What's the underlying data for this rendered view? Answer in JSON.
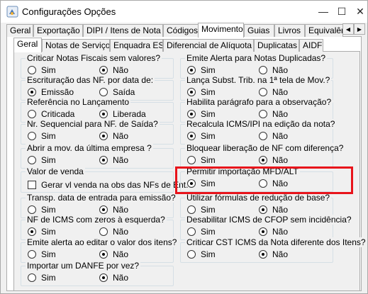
{
  "window": {
    "title": "Configurações Opções",
    "minimize": "—",
    "maximize": "☐",
    "close": "✕"
  },
  "top_tabs": [
    {
      "label": "Geral",
      "active": false
    },
    {
      "label": "Exportação",
      "active": false
    },
    {
      "label": "DIPI / Itens de Nota",
      "active": false
    },
    {
      "label": "Códigos",
      "active": false
    },
    {
      "label": "Movimento",
      "active": true
    },
    {
      "label": "Guias",
      "active": false
    },
    {
      "label": "Livros",
      "active": false
    },
    {
      "label": "Equivalênci",
      "active": false
    }
  ],
  "tab_scroll": {
    "left": "◀",
    "right": "▶"
  },
  "inner_tabs": [
    {
      "label": "Geral",
      "active": true
    },
    {
      "label": "Notas de Serviço",
      "active": false
    },
    {
      "label": "Enquadra ES",
      "active": false
    },
    {
      "label": "Diferencial de Alíquota",
      "active": false
    },
    {
      "label": "Duplicatas",
      "active": false
    },
    {
      "label": "AIDF",
      "active": false
    }
  ],
  "left_groups": [
    {
      "title": "Criticar Notas Fiscais sem valores?",
      "options": [
        {
          "label": "Sim",
          "checked": false
        },
        {
          "label": "Não",
          "checked": true
        }
      ]
    },
    {
      "title": "Escrituração das NF. por data de:",
      "options": [
        {
          "label": "Emissão",
          "checked": true
        },
        {
          "label": "Saída",
          "checked": false
        }
      ]
    },
    {
      "title": "Referência no Lançamento",
      "options": [
        {
          "label": "Criticada",
          "checked": false
        },
        {
          "label": "Liberada",
          "checked": true
        }
      ]
    },
    {
      "title": "Nr. Sequencial para NF. de Saída?",
      "options": [
        {
          "label": "Sim",
          "checked": false
        },
        {
          "label": "Não",
          "checked": true
        }
      ]
    },
    {
      "title": "Abrir a mov. da última empresa ?",
      "options": [
        {
          "label": "Sim",
          "checked": false
        },
        {
          "label": "Não",
          "checked": true
        }
      ]
    },
    {
      "title": "Valor de venda",
      "checkbox": {
        "label": "Gerar vl venda na obs das NFs de Ent.",
        "checked": false
      }
    },
    {
      "title": "Transp. data de entrada para emissão?",
      "options": [
        {
          "label": "Sim",
          "checked": false
        },
        {
          "label": "Não",
          "checked": true
        }
      ]
    },
    {
      "title": "NF de ICMS com zeros à esquerda?",
      "options": [
        {
          "label": "Sim",
          "checked": true
        },
        {
          "label": "Não",
          "checked": false
        }
      ]
    },
    {
      "title": "Emite alerta ao editar o valor dos itens?",
      "options": [
        {
          "label": "Sim",
          "checked": false
        },
        {
          "label": "Não",
          "checked": true
        }
      ]
    },
    {
      "title": "Importar um DANFE por vez?",
      "options": [
        {
          "label": "Sim",
          "checked": false
        },
        {
          "label": "Não",
          "checked": true
        }
      ]
    }
  ],
  "right_groups": [
    {
      "title": "Emite Alerta para Notas Duplicadas?",
      "options": [
        {
          "label": "Sim",
          "checked": true
        },
        {
          "label": "Não",
          "checked": false
        }
      ]
    },
    {
      "title": "Lança Subst. Trib. na 1ª tela de Mov.?",
      "options": [
        {
          "label": "Sim",
          "checked": true
        },
        {
          "label": "Não",
          "checked": false
        }
      ]
    },
    {
      "title": "Habilita parágrafo para a observação?",
      "options": [
        {
          "label": "Sim",
          "checked": true
        },
        {
          "label": "Não",
          "checked": false
        }
      ]
    },
    {
      "title": "Recalcula ICMS/IPI na edição da nota?",
      "options": [
        {
          "label": "Sim",
          "checked": true
        },
        {
          "label": "Não",
          "checked": false
        }
      ]
    },
    {
      "title": "Bloquear liberação de NF com diferença?",
      "options": [
        {
          "label": "Sim",
          "checked": false
        },
        {
          "label": "Não",
          "checked": true
        }
      ]
    },
    {
      "title": "Permitir importação MFD/ALT",
      "options": [
        {
          "label": "Sim",
          "checked": true
        },
        {
          "label": "Não",
          "checked": false
        }
      ]
    },
    {
      "title": "Utilizar fórmulas de redução de base?",
      "options": [
        {
          "label": "Sim",
          "checked": false
        },
        {
          "label": "Não",
          "checked": true
        }
      ]
    },
    {
      "title": "Desabilitar ICMS de CFOP sem incidência?",
      "options": [
        {
          "label": "Sim",
          "checked": false
        },
        {
          "label": "Não",
          "checked": true
        }
      ]
    },
    {
      "title": "Criticar CST ICMS da Nota diferente dos Itens?",
      "options": [
        {
          "label": "Sim",
          "checked": false
        },
        {
          "label": "Não",
          "checked": true
        }
      ]
    }
  ],
  "colors": {
    "highlight": "#e8141b",
    "panel": "#f0f0f0",
    "border": "#adadad"
  }
}
